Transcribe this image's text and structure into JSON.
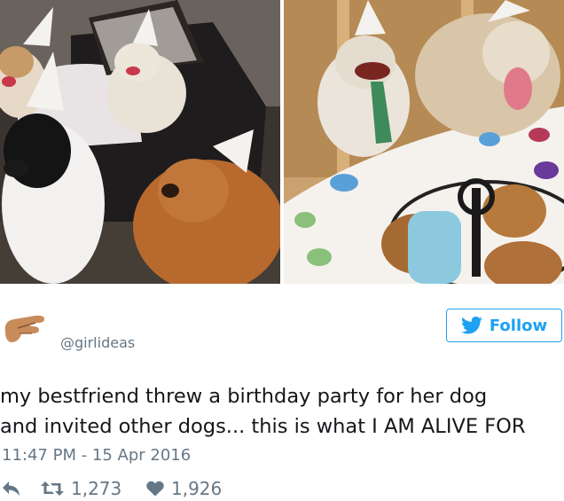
{
  "tweet": {
    "handle": "@girlideas",
    "follow_label": "Follow",
    "text_line1": "my bestfriend threw a birthday party for her dog",
    "text_line2": "and invited other dogs... this is what I AM ALIVE FOR",
    "timestamp": "11:47 PM - 15 Apr 2016",
    "retweets": "1,273",
    "likes": "1,926"
  },
  "colors": {
    "twitter_blue": "#1da1f2",
    "meta_gray": "#657786"
  },
  "icons": {
    "avatar": "pinching-hand-emoji",
    "follow": "twitter-bird-icon",
    "reply": "reply-icon",
    "retweet": "retweet-icon",
    "like": "heart-icon"
  }
}
